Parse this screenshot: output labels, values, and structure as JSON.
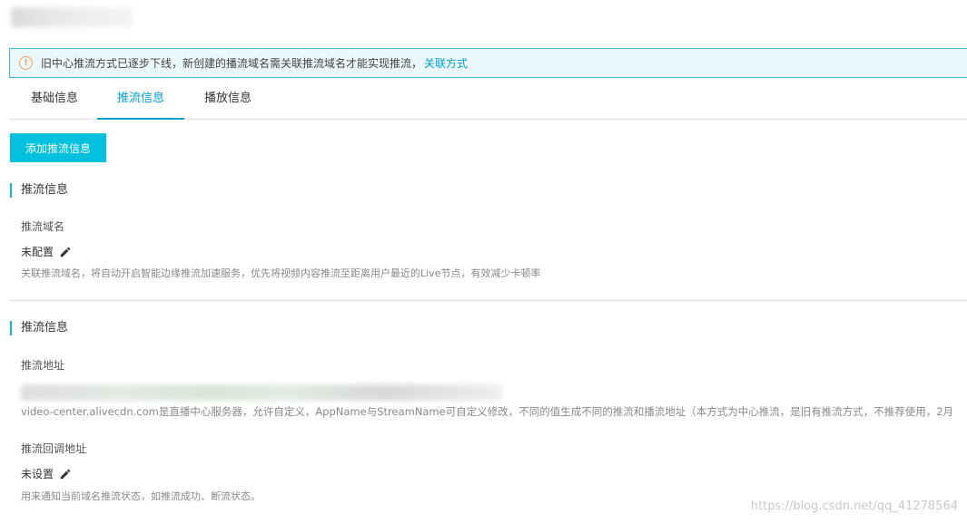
{
  "notice": {
    "text": "旧中心推流方式已逐步下线，新创建的播流域名需关联推流域名才能实现推流，",
    "link": "关联方式",
    "icon": "info-icon",
    "accent": "#00a2c9"
  },
  "tabs": [
    {
      "label": "基础信息",
      "active": false
    },
    {
      "label": "推流信息",
      "active": true
    },
    {
      "label": "播放信息",
      "active": false
    }
  ],
  "add_button": "添加推流信息",
  "section1": {
    "title": "推流信息",
    "field_label": "推流域名",
    "field_value": "未配置",
    "description": "关联推流域名，将自动开启智能边缘推流加速服务，优先将视频内容推流至距离用户最近的Live节点，有效减少卡顿率"
  },
  "section2": {
    "title": "推流信息",
    "address_label": "推流地址",
    "address_description": "video-center.alivecdn.com是直播中心服务器，允许自定义，AppName与StreamName可自定义修改，不同的值生成不同的推流和播流地址（本方式为中心推流，是旧有推流方式，不推荐使用，2月",
    "callback_label": "推流回调地址",
    "callback_value": "未设置",
    "callback_description": "用来通知当前域名推流状态，如推流成功、断流状态。"
  },
  "watermark": "https://blog.csdn.net/qq_41278564",
  "colors": {
    "brand": "#00c1de",
    "link": "#00a2c9",
    "notice_border": "#37b8d1",
    "notice_bg": "#eaf8fb"
  }
}
